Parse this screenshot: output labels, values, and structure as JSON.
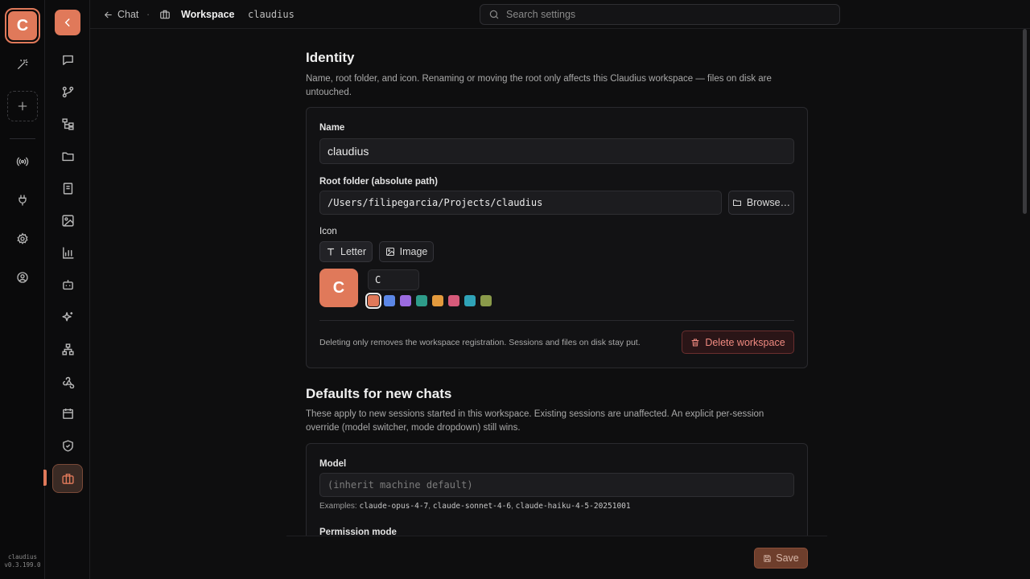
{
  "colors": {
    "accent": "#e0795a",
    "background": "#0e0e0f",
    "danger": "#f08a80"
  },
  "rail": {
    "workspace_letter": "C",
    "footer_name": "claudius",
    "footer_version": "v0.3.199.0",
    "icons": [
      "magic-wand-icon",
      "plus-icon",
      "broadcast-icon",
      "plug-icon",
      "gear-icon",
      "user-circle-icon"
    ]
  },
  "nav": {
    "icons": [
      "chevron-left-icon",
      "chat-icon",
      "git-branch-icon",
      "tree-icon",
      "folder-icon",
      "book-icon",
      "image-icon",
      "bar-chart-icon",
      "bot-icon",
      "sparkles-icon",
      "sitemap-icon",
      "webhook-icon",
      "calendar-icon",
      "shield-check-icon",
      "briefcase-icon"
    ]
  },
  "topbar": {
    "back_label": "Chat",
    "separator": "·",
    "workspace_label": "Workspace",
    "workspace_name": "claudius",
    "search_placeholder": "Search settings"
  },
  "identity": {
    "title": "Identity",
    "description": "Name, root folder, and icon. Renaming or moving the root only affects this Claudius workspace — files on disk are untouched.",
    "name_label": "Name",
    "name_value": "claudius",
    "root_label": "Root folder (absolute path)",
    "root_value": "/Users/filipegarcia/Projects/claudius",
    "browse_label": "Browse…",
    "icon_label": "Icon",
    "letter_tab": "Letter",
    "image_tab": "Image",
    "preview_letter": "C",
    "letter_value": "C",
    "swatches": [
      "#e0795a",
      "#5b86e6",
      "#9b6be0",
      "#2e9c8a",
      "#e39a3d",
      "#d65a7a",
      "#2fa3b8",
      "#8a9a4a"
    ],
    "selected_swatch": 0,
    "delete_note": "Deleting only removes the workspace registration. Sessions and files on disk stay put.",
    "delete_label": "Delete workspace"
  },
  "defaults": {
    "title": "Defaults for new chats",
    "description": "These apply to new sessions started in this workspace. Existing sessions are unaffected. An explicit per-session override (model switcher, mode dropdown) still wins.",
    "model_label": "Model",
    "model_placeholder": "(inherit machine default)",
    "examples_prefix": "Examples:",
    "examples": [
      "claude-opus-4-7",
      "claude-sonnet-4-6",
      "claude-haiku-4-5-20251001"
    ],
    "permission_label": "Permission mode"
  },
  "footer": {
    "save_label": "Save"
  }
}
